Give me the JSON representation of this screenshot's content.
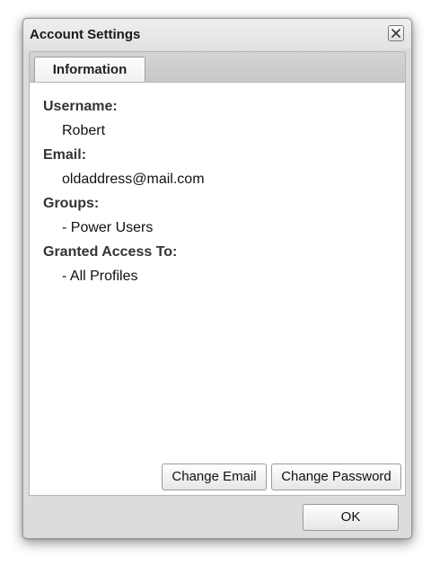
{
  "dialog": {
    "title": "Account Settings",
    "close_icon": "close-icon"
  },
  "tabs": [
    {
      "label": "Information",
      "active": true
    }
  ],
  "info": {
    "username_label": "Username:",
    "username_value": "Robert",
    "email_label": "Email:",
    "email_value": "oldaddress@mail.com",
    "groups_label": "Groups:",
    "groups_items": [
      "- Power Users"
    ],
    "access_label": "Granted Access To:",
    "access_items": [
      "- All Profiles"
    ]
  },
  "buttons": {
    "change_email": "Change Email",
    "change_password": "Change Password",
    "ok": "OK"
  }
}
